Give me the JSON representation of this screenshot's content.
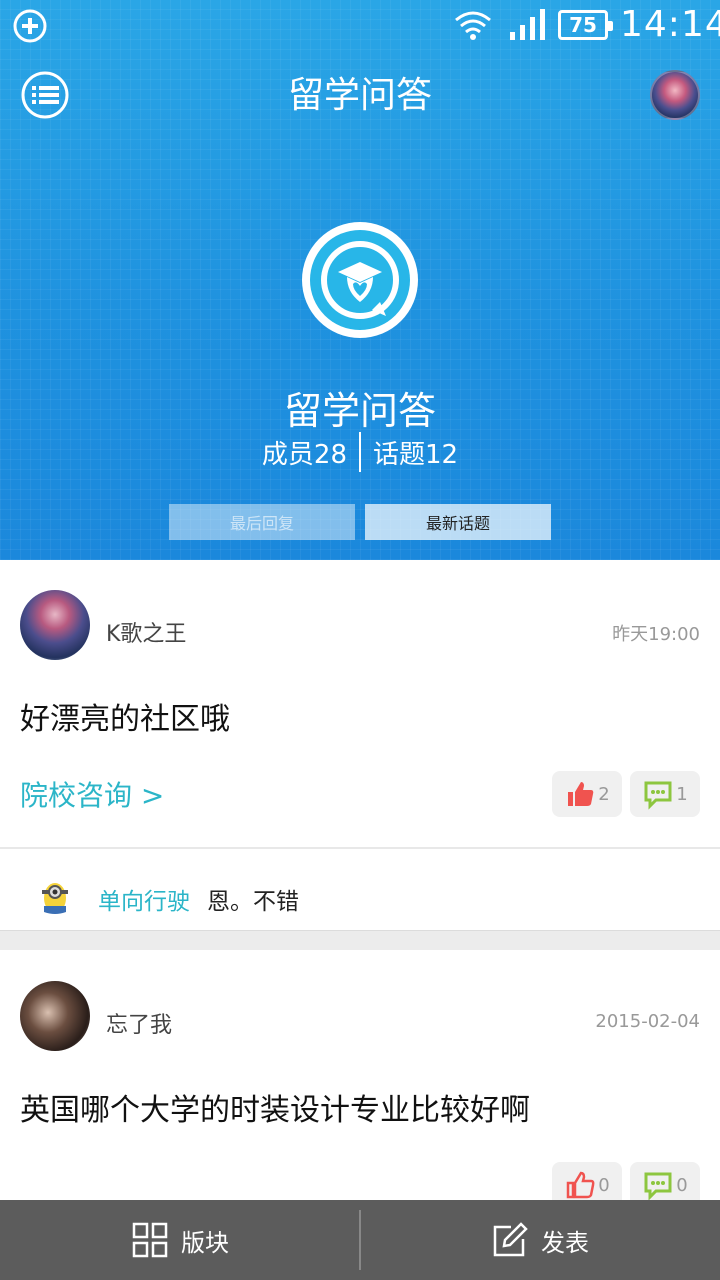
{
  "status_bar": {
    "battery": "75",
    "time": "14:14"
  },
  "app_bar": {
    "title": "留学问答"
  },
  "community": {
    "name": "留学问答",
    "members": "成员28",
    "topics": "话题12",
    "segments": [
      "最后回复",
      "最新话题"
    ]
  },
  "posts": [
    {
      "username": "K歌之王",
      "time": "昨天19:00",
      "title": "好漂亮的社区哦",
      "category": "院校咨询 >",
      "likes": "2",
      "comments": "1",
      "reply": {
        "user": "单向行驶",
        "text": "恩。不错"
      }
    },
    {
      "username": "忘了我",
      "time": "2015-02-04",
      "title": "英国哪个大学的时装设计专业比较好啊",
      "likes": "0",
      "comments": "0"
    }
  ],
  "bottom_nav": {
    "board": "版块",
    "post": "发表"
  },
  "colors": {
    "header_blue": "#1f92df",
    "accent_teal": "#2bb5c8",
    "like_red": "#f0534f",
    "comment_green": "#8dc63f"
  }
}
